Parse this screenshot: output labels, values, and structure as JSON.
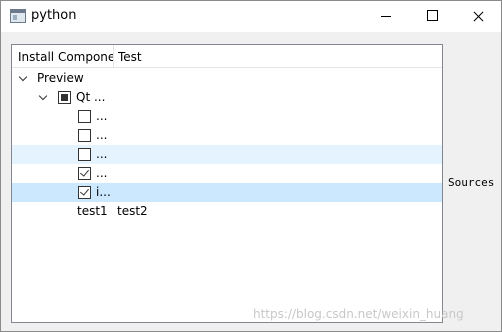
{
  "window": {
    "title": "python"
  },
  "tree": {
    "headers": [
      "Install Compone",
      "Test"
    ],
    "root": {
      "label": "Preview"
    },
    "group": {
      "label": "Qt ..."
    },
    "items": [
      {
        "label": "...",
        "checked": false
      },
      {
        "label": "...",
        "checked": false
      },
      {
        "label": "...",
        "checked": false,
        "state": "hover"
      },
      {
        "label": "...",
        "checked": true
      },
      {
        "label": "i...",
        "checked": true,
        "state": "selected"
      }
    ],
    "extra_row": {
      "col1": "test1",
      "col2": "test2"
    }
  },
  "side_label": "Sources",
  "watermark": "https://blog.csdn.net/weixin_huang"
}
